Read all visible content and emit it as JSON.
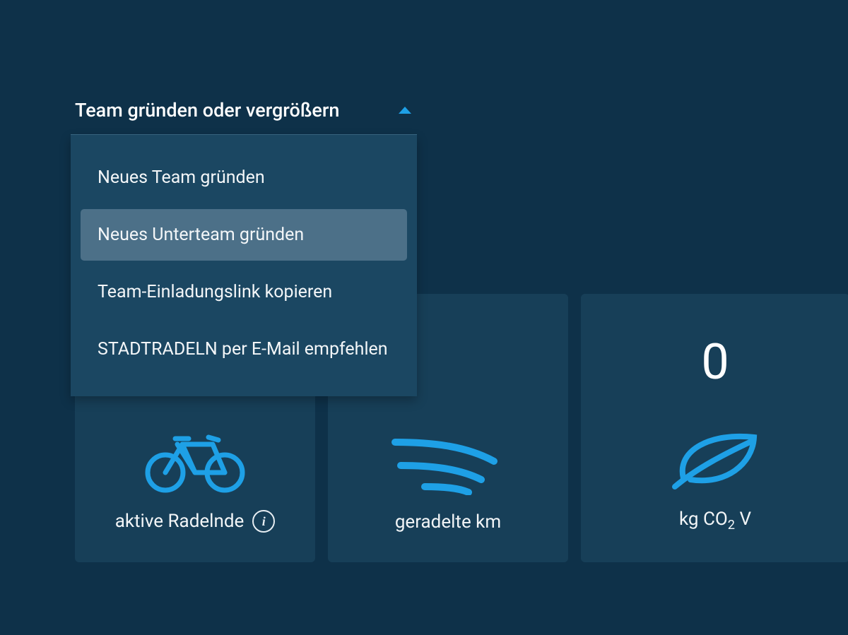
{
  "dropdown": {
    "trigger_label": "Team gründen oder vergrößern",
    "items": [
      {
        "label": "Neues Team gründen",
        "hovered": false
      },
      {
        "label": "Neues Unterteam gründen",
        "hovered": true
      },
      {
        "label": "Team-Einladungslink kopieren",
        "hovered": false
      },
      {
        "label": "STADTRADELN per E-Mail empfehlen",
        "hovered": false
      }
    ]
  },
  "stats": {
    "cards": [
      {
        "value": "",
        "label": "aktive Radelnde",
        "has_info": true,
        "icon": "bicycle"
      },
      {
        "value": "",
        "label": "geradelte km",
        "has_info": false,
        "icon": "swoosh"
      },
      {
        "value": "0",
        "label_prefix": "kg CO",
        "label_sub": "2",
        "label_suffix": " V",
        "has_info": false,
        "icon": "leaf"
      }
    ]
  },
  "colors": {
    "bg": "#0e3149",
    "card": "#173f58",
    "dropdown_panel": "#1b4762",
    "dropdown_hover": "#4c7088",
    "accent": "#1ea0e6",
    "text": "#ffffff"
  }
}
